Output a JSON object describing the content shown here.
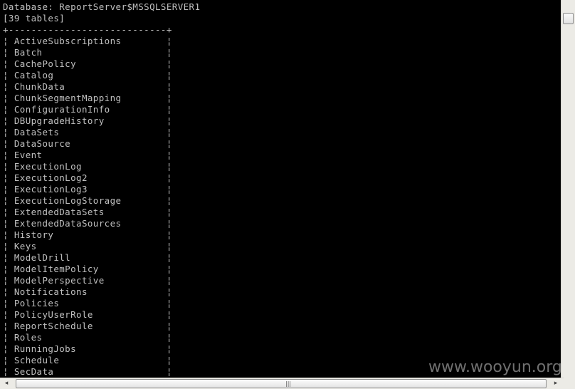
{
  "console": {
    "lines": [
      "Database: ReportServer$MSSQLSERVER1",
      "[39 tables]",
      "+----------------------------+",
      "¦ ActiveSubscriptions        ¦",
      "¦ Batch                      ¦",
      "¦ CachePolicy                ¦",
      "¦ Catalog                    ¦",
      "¦ ChunkData                  ¦",
      "¦ ChunkSegmentMapping        ¦",
      "¦ ConfigurationInfo          ¦",
      "¦ DBUpgradeHistory           ¦",
      "¦ DataSets                   ¦",
      "¦ DataSource                 ¦",
      "¦ Event                      ¦",
      "¦ ExecutionLog               ¦",
      "¦ ExecutionLog2              ¦",
      "¦ ExecutionLog3              ¦",
      "¦ ExecutionLogStorage        ¦",
      "¦ ExtendedDataSets           ¦",
      "¦ ExtendedDataSources        ¦",
      "¦ History                    ¦",
      "¦ Keys                       ¦",
      "¦ ModelDrill                 ¦",
      "¦ ModelItemPolicy            ¦",
      "¦ ModelPerspective           ¦",
      "¦ Notifications              ¦",
      "¦ Policies                   ¦",
      "¦ PolicyUserRole             ¦",
      "¦ ReportSchedule             ¦",
      "¦ Roles                      ¦",
      "¦ RunningJobs                ¦",
      "¦ Schedule                   ¦",
      "¦ SecData                    ¦"
    ]
  },
  "scrollbar": {
    "left_arrow": "◂",
    "right_arrow": "▸",
    "grip": "|||"
  },
  "watermark": "www.wooyun.org",
  "colors": {
    "background": "#000000",
    "text": "#c0c0c0",
    "scrollbar": "#ecebe6"
  }
}
